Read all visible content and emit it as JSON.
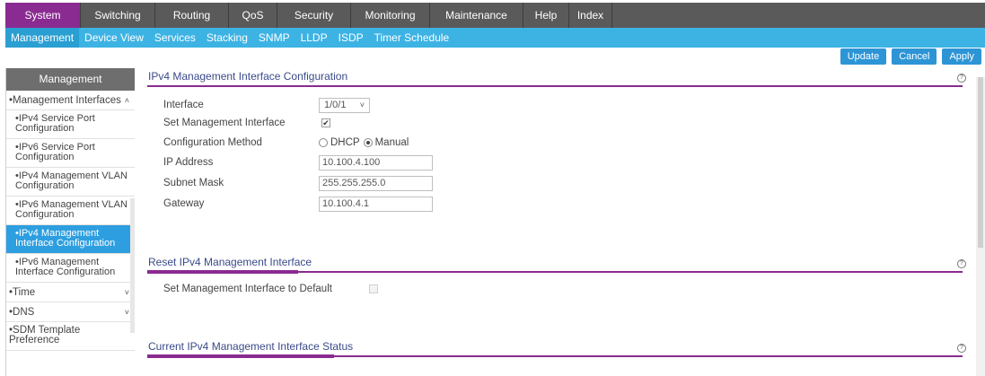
{
  "topnav": {
    "tabs": [
      "System",
      "Switching",
      "Routing",
      "QoS",
      "Security",
      "Monitoring",
      "Maintenance",
      "Help",
      "Index"
    ]
  },
  "subnav": {
    "items": [
      "Management",
      "Device View",
      "Services",
      "Stacking",
      "SNMP",
      "LLDP",
      "ISDP",
      "Timer Schedule"
    ]
  },
  "actions": {
    "update": "Update",
    "cancel": "Cancel",
    "apply": "Apply"
  },
  "sidebar": {
    "header": "Management",
    "groups": {
      "mgmt_interfaces": "Management Interfaces",
      "time": "Time",
      "dns": "DNS",
      "sdm": "SDM Template Preference"
    },
    "items": [
      "IPv4 Service Port Configuration",
      "IPv6 Service Port Configuration",
      "IPv4 Management VLAN Configuration",
      "IPv6 Management VLAN Configuration",
      "IPv4 Management Interface Configuration",
      "IPv6 Management Interface Configuration"
    ]
  },
  "config": {
    "title": "IPv4 Management Interface Configuration",
    "labels": {
      "interface": "Interface",
      "set_mgmt": "Set Management Interface",
      "method": "Configuration Method",
      "ip": "IP Address",
      "mask": "Subnet Mask",
      "gateway": "Gateway"
    },
    "interface_value": "1/0/1",
    "set_mgmt_checked": true,
    "method_options": {
      "dhcp": "DHCP",
      "manual": "Manual"
    },
    "method_selected": "Manual",
    "ip_value": "10.100.4.100",
    "mask_value": "255.255.255.0",
    "gateway_value": "10.100.4.1"
  },
  "reset": {
    "title": "Reset IPv4 Management Interface",
    "label": "Set Management Interface to Default",
    "checked": false
  },
  "status": {
    "title": "Current IPv4 Management Interface Status"
  }
}
